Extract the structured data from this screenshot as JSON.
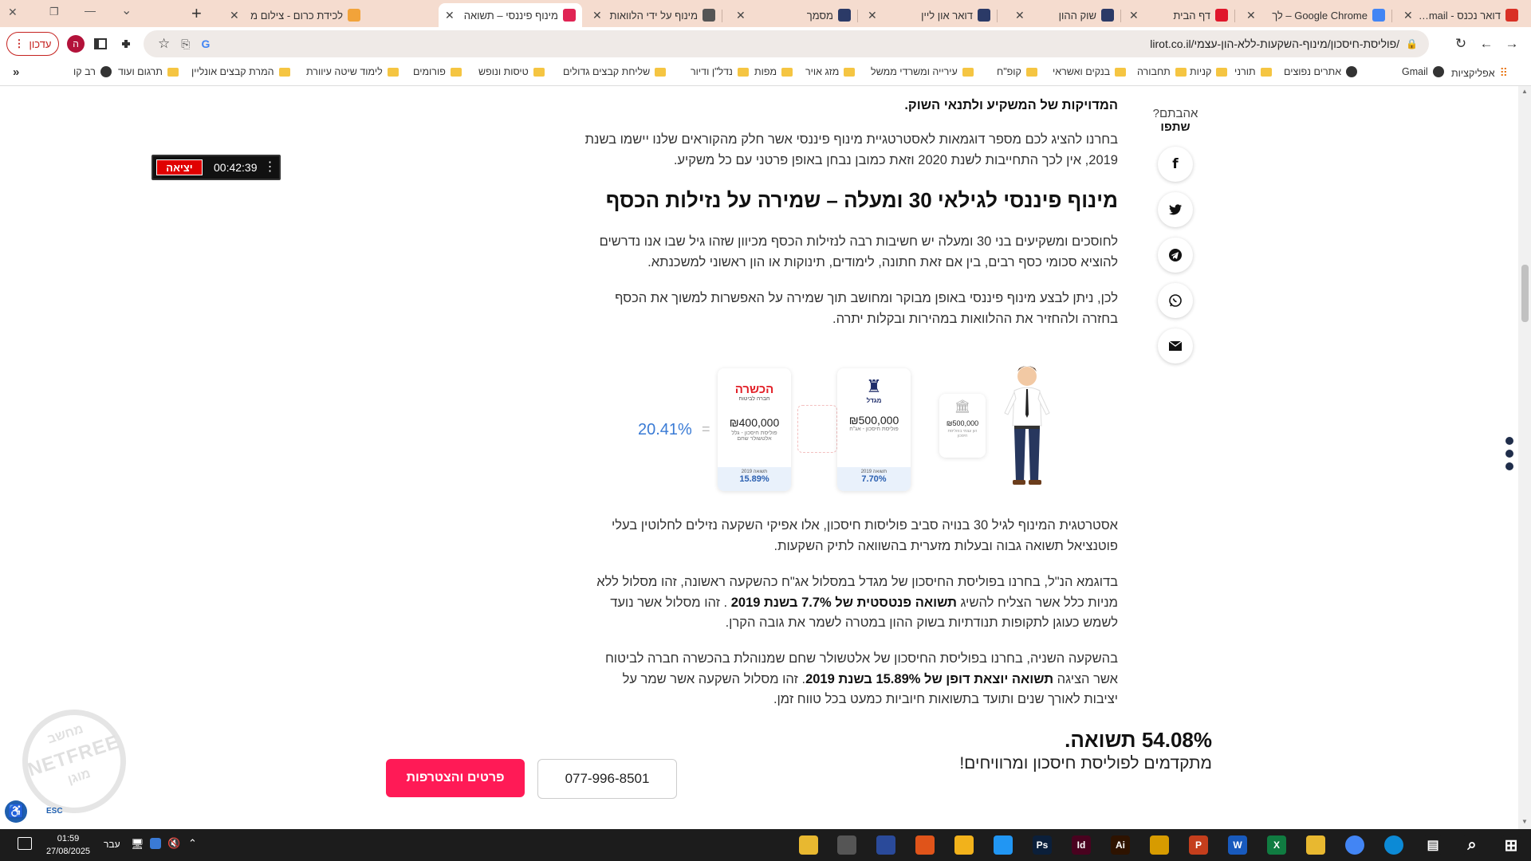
{
  "window_controls": {
    "close": "✕",
    "restore": "❐",
    "minimize": "—",
    "tab_search": "⌄"
  },
  "tabs": [
    {
      "title": "דואר נכנס - Gmail ‏om",
      "icon": "gmail-icon",
      "color": "#d93025"
    },
    {
      "title": "Google Chrome – לך",
      "icon": "chrome-icon",
      "color": "#4285f4"
    },
    {
      "title": "דף הבית",
      "icon": "diamond-icon",
      "color": "#e0162b"
    },
    {
      "title": "שוק ההון",
      "icon": "chart-icon",
      "color": "#2b3a67"
    },
    {
      "title": "דואר און ליין",
      "icon": "chart-icon",
      "color": "#2b3a67"
    },
    {
      "title": "מסמך",
      "icon": "doc-icon",
      "color": "#2b3a67"
    },
    {
      "title": "מינוף על ידי הלוואות",
      "icon": "page-icon",
      "color": "#555"
    },
    {
      "title": "מינוף פיננסי – תשואה",
      "icon": "page-icon",
      "color": "#e02454"
    },
    {
      "title": "לכידת כרום - צילום מ",
      "icon": "rainbow-icon",
      "color": "#f2a33a"
    }
  ],
  "new_tab": "+",
  "toolbar": {
    "url": "lirot.co.il/פוליסת-חיסכון/מינוף-השקעות-ללא-הון-עצמי/",
    "update_label": "עדכון",
    "profile_initial": "ה"
  },
  "bookmarks": [
    {
      "label": "אפליקציות",
      "icon": "apps-icon"
    },
    {
      "label": "Gmail",
      "icon": "globe-icon"
    },
    {
      "label": "אתרים נפוצים",
      "icon": "globe-icon"
    },
    {
      "label": "תורני",
      "icon": "folder-icon"
    },
    {
      "label": "קניות",
      "icon": "folder-icon"
    },
    {
      "label": "תחבורה",
      "icon": "folder-icon"
    },
    {
      "label": "בנקים ואשראי",
      "icon": "folder-icon"
    },
    {
      "label": "קופ\"ח",
      "icon": "folder-icon"
    },
    {
      "label": "עירייה ומשרדי ממשל",
      "icon": "folder-icon"
    },
    {
      "label": "מזג אויר",
      "icon": "folder-icon"
    },
    {
      "label": "מפות",
      "icon": "folder-icon"
    },
    {
      "label": "נדל\"ן ודיור",
      "icon": "folder-icon"
    },
    {
      "label": "שליחת קבצים גדולים",
      "icon": "folder-icon"
    },
    {
      "label": "טיסות ונופש",
      "icon": "folder-icon"
    },
    {
      "label": "פורומים",
      "icon": "folder-icon"
    },
    {
      "label": "לימוד שיטה עיוורת",
      "icon": "folder-icon"
    },
    {
      "label": "המרת קבצים אונליין",
      "icon": "folder-icon"
    },
    {
      "label": "תרגום ועוד",
      "icon": "folder-icon"
    },
    {
      "label": "רב קו",
      "icon": "globe-icon"
    }
  ],
  "bookmarks_more": "»",
  "timer": {
    "exit_label": "יציאה",
    "time": "00:42:39"
  },
  "article": {
    "top_partial": "המדויקות של המשקיע ולתנאי השוק.",
    "intro": "בחרנו להציג לכם מספר דוגמאות לאסטרטגיית מינוף פיננסי אשר חלק מהקוראים שלנו יישמו בשנת 2019, אין לכך התחייבות לשנת 2020 וזאת כמובן נבחן באופן פרטני עם כל משקיע.",
    "heading": "מינוף פיננסי לגילאי 30 ומעלה – שמירה על נזילות הכסף",
    "p1": "לחוסכים ומשקיעים בני 30 ומעלה יש חשיבות רבה לנזילות הכסף מכיוון שזהו גיל שבו אנו נדרשים להוציא סכומי כסף רבים, בין אם זאת חתונה, לימודים, תינוקות או הון ראשוני למשכנתא.",
    "p2": "לכן, ניתן לבצע מינוף פיננסי באופן מבוקר ומחושב תוך שמירה על האפשרות למשוך את הכסף בחזרה ולהחזיר את ההלוואות במהירות ובקלות יתרה.",
    "p3": "אסטרטגית המינוף לגיל 30 בנויה סביב פוליסות חיסכון, אלו אפיקי השקעה נזילים לחלוטין בעלי פוטנציאל תשואה גבוה ובעלות מזערית בהשוואה לתיק השקעות.",
    "p4_a": "בדוגמא הנ\"ל, בחרנו בפוליסת החיסכון של מגדל במסלול אג\"ח כהשקעה ראשונה, זהו מסלול ללא מניות כלל אשר הצליח להשיג ",
    "p4_bold": "תשואה פנטסטית של 7.7% בשנת 2019",
    "p4_b": " . זהו מסלול אשר נועד לשמש כעוגן לתקופות תנודתיות בשוק ההון במטרה לשמר את גובה הקרן.",
    "p5_a": "בהשקעה השניה, בחרנו בפוליסת החיסכון של אלטשולר שחם שמנוהלת בהכשרה חברה לביטוח אשר הציגה ",
    "p5_bold": "תשואה יוצאת דופן של 15.89% בשנת 2019",
    "p5_b": ". זהו מסלול השקעה אשר שמר על יציבות לאורך שנים ותועד בתשואות חיוביות כמעט בכל טווח זמן."
  },
  "share": {
    "title_line1": "אהבתם?",
    "title_line2": "שתפו"
  },
  "infographic": {
    "result": "20.41%",
    "equals": "=",
    "card1": {
      "brand": "הכשרה",
      "brand_sub": "חברה לביטוח",
      "amount": "₪400,000",
      "desc": "פוליסת חיסכון - גלל אלטשולר שחם",
      "year": "תשואה 2019",
      "pct": "15.89%"
    },
    "card2": {
      "brand": "מגדל",
      "amount": "₪500,000",
      "desc": "פוליסת חיסכון - אג\"ח",
      "year": "תשואה 2019",
      "pct": "7.70%"
    },
    "card3": {
      "amount": "₪500,000",
      "desc": "הון עצמי בפוליסת חיסכון"
    }
  },
  "cta": {
    "pct_text": "54.08% תשואה.",
    "sub_text": "מתקדמים לפוליסת חיסכון ומרוויחים!",
    "phone": "077-996-8501",
    "join_label": "פרטים והצטרפות"
  },
  "watermark": {
    "top": "מחשב",
    "middle": "NETFREE",
    "bottom": "מוגן"
  },
  "accessibility": {
    "esc": "ESC"
  },
  "taskbar": {
    "time": "01:59",
    "date": "27/08/2025",
    "lang": "עבר",
    "apps": [
      {
        "name": "explorer",
        "label": "",
        "color": "#e8b830"
      },
      {
        "name": "calculator",
        "label": "",
        "color": "#555"
      },
      {
        "name": "app",
        "label": "",
        "color": "#2a4a9a"
      },
      {
        "name": "maps",
        "label": "",
        "color": "#e0541a"
      },
      {
        "name": "app2",
        "label": "",
        "color": "#f2b21b"
      },
      {
        "name": "snip",
        "label": "",
        "color": "#2196f3"
      },
      {
        "name": "photoshop",
        "label": "Ps",
        "color": "#0b1f3a"
      },
      {
        "name": "indesign",
        "label": "Id",
        "color": "#49021f"
      },
      {
        "name": "illustrator",
        "label": "Ai",
        "color": "#2e1300"
      },
      {
        "name": "app3",
        "label": "",
        "color": "#d79b00"
      },
      {
        "name": "powerpoint",
        "label": "P",
        "color": "#c43e1c"
      },
      {
        "name": "word",
        "label": "W",
        "color": "#185abd"
      },
      {
        "name": "excel",
        "label": "X",
        "color": "#107c41"
      },
      {
        "name": "files",
        "label": "",
        "color": "#e8b830"
      },
      {
        "name": "chrome",
        "label": "",
        "color": "#4285f4"
      },
      {
        "name": "edge",
        "label": "",
        "color": "#0c8ad6"
      },
      {
        "name": "taskview",
        "label": "",
        "color": "#1c1c1c"
      },
      {
        "name": "search",
        "label": "",
        "color": "#1c1c1c"
      },
      {
        "name": "start",
        "label": "",
        "color": "#1c1c1c"
      }
    ]
  },
  "colors": {
    "accent": "#ff1a56",
    "tabbar": "#f5dccf",
    "link_blue": "#3a7bd5"
  }
}
